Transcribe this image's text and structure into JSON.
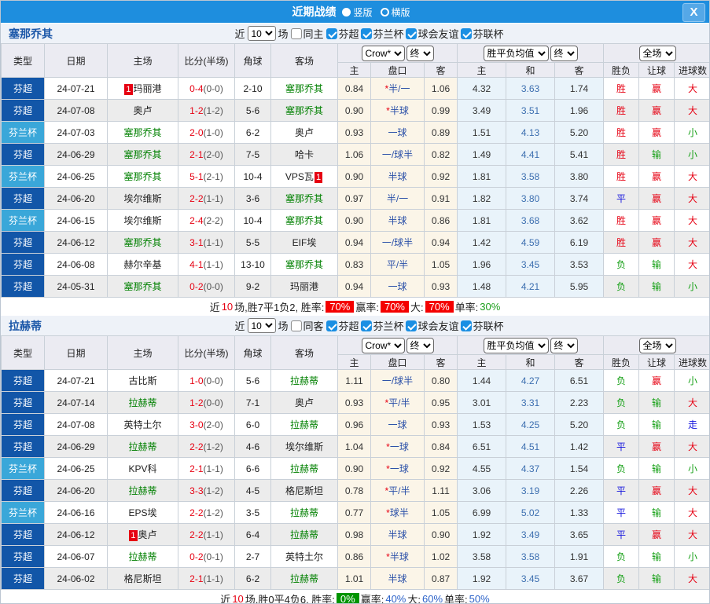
{
  "titlebar": {
    "title": "近期战绩",
    "layout_vertical": "竖版",
    "layout_horizontal": "横版",
    "close": "X"
  },
  "filter": {
    "near": "近",
    "games": "场",
    "count": "10",
    "leagues": [
      "芬超",
      "芬兰杯",
      "球会友谊",
      "芬联杯"
    ]
  },
  "table_header": {
    "type": "类型",
    "date": "日期",
    "home": "主场",
    "score": "比分(半场)",
    "corners": "角球",
    "away": "客场",
    "crow_select": "Crow*",
    "final_select": "终",
    "avg_select": "胜平负均值",
    "final_select2": "终",
    "scope_select": "全场",
    "sub_home": "主",
    "sub_handicap": "盘口",
    "sub_away": "客",
    "sub_avg_home": "主",
    "sub_avg_draw": "和",
    "sub_avg_away": "客",
    "sub_result": "胜负",
    "sub_handicap_result": "让球",
    "sub_goals": "进球数"
  },
  "league_colors": {
    "芬超": "#1256a8",
    "芬兰杯": "#3aa7d9"
  },
  "result_colors": {
    "胜": "#e60012",
    "平": "#1515dd",
    "负": "#16a016",
    "赢": "#e60012",
    "输": "#16a016",
    "走": "#1515dd",
    "大": "#e60012",
    "小": "#16a016"
  },
  "self_color": "#008000",
  "sections": [
    {
      "team": "塞那乔其",
      "same_label": "同主",
      "rows": [
        {
          "league": "芬超",
          "date": "24-07-21",
          "home": "玛丽港",
          "home_self": false,
          "home_badge": "1",
          "home_badge_pos": "before",
          "score": "0-4",
          "half": "(0-0)",
          "corners": "2-10",
          "away": "塞那乔其",
          "away_self": true,
          "odds_home": "0.84",
          "handicap_star": "*",
          "handicap": "半/一",
          "odds_away": "1.06",
          "avg_home": "4.32",
          "avg_draw": "3.63",
          "avg_away": "1.74",
          "result": "胜",
          "handicap_result": "赢",
          "goals": "大"
        },
        {
          "league": "芬超",
          "date": "24-07-08",
          "home": "奥卢",
          "home_self": false,
          "score": "1-2",
          "half": "(1-2)",
          "corners": "5-6",
          "away": "塞那乔其",
          "away_self": true,
          "odds_home": "0.90",
          "handicap_star": "*",
          "handicap": "半球",
          "odds_away": "0.99",
          "avg_home": "3.49",
          "avg_draw": "3.51",
          "avg_away": "1.96",
          "result": "胜",
          "handicap_result": "赢",
          "goals": "大"
        },
        {
          "league": "芬兰杯",
          "date": "24-07-03",
          "home": "塞那乔其",
          "home_self": true,
          "score": "2-0",
          "half": "(1-0)",
          "corners": "6-2",
          "away": "奥卢",
          "away_self": false,
          "odds_home": "0.93",
          "handicap_star": "",
          "handicap": "一球",
          "odds_away": "0.89",
          "avg_home": "1.51",
          "avg_draw": "4.13",
          "avg_away": "5.20",
          "result": "胜",
          "handicap_result": "赢",
          "goals": "小"
        },
        {
          "league": "芬超",
          "date": "24-06-29",
          "home": "塞那乔其",
          "home_self": true,
          "score": "2-1",
          "half": "(2-0)",
          "corners": "7-5",
          "away": "哈卡",
          "away_self": false,
          "odds_home": "1.06",
          "handicap_star": "",
          "handicap": "一/球半",
          "odds_away": "0.82",
          "avg_home": "1.49",
          "avg_draw": "4.41",
          "avg_away": "5.41",
          "result": "胜",
          "handicap_result": "输",
          "goals": "小"
        },
        {
          "league": "芬兰杯",
          "date": "24-06-25",
          "home": "塞那乔其",
          "home_self": true,
          "score": "5-1",
          "half": "(2-1)",
          "corners": "10-4",
          "away": "VPS瓦",
          "away_self": false,
          "away_badge": "1",
          "away_badge_pos": "after",
          "odds_home": "0.90",
          "handicap_star": "",
          "handicap": "半球",
          "odds_away": "0.92",
          "avg_home": "1.81",
          "avg_draw": "3.58",
          "avg_away": "3.80",
          "result": "胜",
          "handicap_result": "赢",
          "goals": "大"
        },
        {
          "league": "芬超",
          "date": "24-06-20",
          "home": "埃尔维斯",
          "home_self": false,
          "score": "2-2",
          "half": "(1-1)",
          "corners": "3-6",
          "away": "塞那乔其",
          "away_self": true,
          "odds_home": "0.97",
          "handicap_star": "",
          "handicap": "半/一",
          "odds_away": "0.91",
          "avg_home": "1.82",
          "avg_draw": "3.80",
          "avg_away": "3.74",
          "result": "平",
          "handicap_result": "赢",
          "goals": "大"
        },
        {
          "league": "芬兰杯",
          "date": "24-06-15",
          "home": "埃尔维斯",
          "home_self": false,
          "score": "2-4",
          "half": "(2-2)",
          "corners": "10-4",
          "away": "塞那乔其",
          "away_self": true,
          "odds_home": "0.90",
          "handicap_star": "",
          "handicap": "半球",
          "odds_away": "0.86",
          "avg_home": "1.81",
          "avg_draw": "3.68",
          "avg_away": "3.62",
          "result": "胜",
          "handicap_result": "赢",
          "goals": "大"
        },
        {
          "league": "芬超",
          "date": "24-06-12",
          "home": "塞那乔其",
          "home_self": true,
          "score": "3-1",
          "half": "(1-1)",
          "corners": "5-5",
          "away": "EIF埃",
          "away_self": false,
          "odds_home": "0.94",
          "handicap_star": "",
          "handicap": "一/球半",
          "odds_away": "0.94",
          "avg_home": "1.42",
          "avg_draw": "4.59",
          "avg_away": "6.19",
          "result": "胜",
          "handicap_result": "赢",
          "goals": "大"
        },
        {
          "league": "芬超",
          "date": "24-06-08",
          "home": "赫尔辛基",
          "home_self": false,
          "score": "4-1",
          "half": "(1-1)",
          "corners": "13-10",
          "away": "塞那乔其",
          "away_self": true,
          "odds_home": "0.83",
          "handicap_star": "",
          "handicap": "平/半",
          "odds_away": "1.05",
          "avg_home": "1.96",
          "avg_draw": "3.45",
          "avg_away": "3.53",
          "result": "负",
          "handicap_result": "输",
          "goals": "大"
        },
        {
          "league": "芬超",
          "date": "24-05-31",
          "home": "塞那乔其",
          "home_self": true,
          "score": "0-2",
          "half": "(0-0)",
          "corners": "9-2",
          "away": "玛丽港",
          "away_self": false,
          "odds_home": "0.94",
          "handicap_star": "",
          "handicap": "一球",
          "odds_away": "0.93",
          "avg_home": "1.48",
          "avg_draw": "4.21",
          "avg_away": "5.95",
          "result": "负",
          "handicap_result": "输",
          "goals": "小"
        }
      ],
      "summary": [
        {
          "t": "近",
          "s": "p"
        },
        {
          "t": "10",
          "s": "r"
        },
        {
          "t": "场,胜7平1负2, 胜率:",
          "s": "p"
        },
        {
          "t": "70%",
          "s": "rb"
        },
        {
          "t": " 赢率:",
          "s": "p"
        },
        {
          "t": "70%",
          "s": "rb"
        },
        {
          "t": " 大:",
          "s": "p"
        },
        {
          "t": "70%",
          "s": "rb"
        },
        {
          "t": " 单率:",
          "s": "p"
        },
        {
          "t": "30%",
          "s": "g"
        }
      ]
    },
    {
      "team": "拉赫蒂",
      "same_label": "同客",
      "rows": [
        {
          "league": "芬超",
          "date": "24-07-21",
          "home": "古比斯",
          "home_self": false,
          "score": "1-0",
          "half": "(0-0)",
          "corners": "5-6",
          "away": "拉赫蒂",
          "away_self": true,
          "odds_home": "1.11",
          "handicap_star": "",
          "handicap": "一/球半",
          "odds_away": "0.80",
          "avg_home": "1.44",
          "avg_draw": "4.27",
          "avg_away": "6.51",
          "result": "负",
          "handicap_result": "赢",
          "goals": "小"
        },
        {
          "league": "芬超",
          "date": "24-07-14",
          "home": "拉赫蒂",
          "home_self": true,
          "score": "1-2",
          "half": "(0-0)",
          "corners": "7-1",
          "away": "奥卢",
          "away_self": false,
          "odds_home": "0.93",
          "handicap_star": "*",
          "handicap": "平/半",
          "odds_away": "0.95",
          "avg_home": "3.01",
          "avg_draw": "3.31",
          "avg_away": "2.23",
          "result": "负",
          "handicap_result": "输",
          "goals": "大"
        },
        {
          "league": "芬超",
          "date": "24-07-08",
          "home": "英特土尔",
          "home_self": false,
          "score": "3-0",
          "half": "(2-0)",
          "corners": "6-0",
          "away": "拉赫蒂",
          "away_self": true,
          "odds_home": "0.96",
          "handicap_star": "",
          "handicap": "一球",
          "odds_away": "0.93",
          "avg_home": "1.53",
          "avg_draw": "4.25",
          "avg_away": "5.20",
          "result": "负",
          "handicap_result": "输",
          "goals": "走"
        },
        {
          "league": "芬超",
          "date": "24-06-29",
          "home": "拉赫蒂",
          "home_self": true,
          "score": "2-2",
          "half": "(1-2)",
          "corners": "4-6",
          "away": "埃尔维斯",
          "away_self": false,
          "odds_home": "1.04",
          "handicap_star": "*",
          "handicap": "一球",
          "odds_away": "0.84",
          "avg_home": "6.51",
          "avg_draw": "4.51",
          "avg_away": "1.42",
          "result": "平",
          "handicap_result": "赢",
          "goals": "大"
        },
        {
          "league": "芬兰杯",
          "date": "24-06-25",
          "home": "KPV科",
          "home_self": false,
          "score": "2-1",
          "half": "(1-1)",
          "corners": "6-6",
          "away": "拉赫蒂",
          "away_self": true,
          "odds_home": "0.90",
          "handicap_star": "*",
          "handicap": "一球",
          "odds_away": "0.92",
          "avg_home": "4.55",
          "avg_draw": "4.37",
          "avg_away": "1.54",
          "result": "负",
          "handicap_result": "输",
          "goals": "小"
        },
        {
          "league": "芬超",
          "date": "24-06-20",
          "home": "拉赫蒂",
          "home_self": true,
          "score": "3-3",
          "half": "(1-2)",
          "corners": "4-5",
          "away": "格尼斯坦",
          "away_self": false,
          "odds_home": "0.78",
          "handicap_star": "*",
          "handicap": "平/半",
          "odds_away": "1.11",
          "avg_home": "3.06",
          "avg_draw": "3.19",
          "avg_away": "2.26",
          "result": "平",
          "handicap_result": "赢",
          "goals": "大"
        },
        {
          "league": "芬兰杯",
          "date": "24-06-16",
          "home": "EPS埃",
          "home_self": false,
          "score": "2-2",
          "half": "(1-2)",
          "corners": "3-5",
          "away": "拉赫蒂",
          "away_self": true,
          "odds_home": "0.77",
          "handicap_star": "*",
          "handicap": "球半",
          "odds_away": "1.05",
          "avg_home": "6.99",
          "avg_draw": "5.02",
          "avg_away": "1.33",
          "result": "平",
          "handicap_result": "输",
          "goals": "大"
        },
        {
          "league": "芬超",
          "date": "24-06-12",
          "home": "奥卢",
          "home_self": false,
          "home_badge": "1",
          "home_badge_pos": "before",
          "score": "2-2",
          "half": "(1-1)",
          "corners": "6-4",
          "away": "拉赫蒂",
          "away_self": true,
          "odds_home": "0.98",
          "handicap_star": "",
          "handicap": "半球",
          "odds_away": "0.90",
          "avg_home": "1.92",
          "avg_draw": "3.49",
          "avg_away": "3.65",
          "result": "平",
          "handicap_result": "赢",
          "goals": "大"
        },
        {
          "league": "芬超",
          "date": "24-06-07",
          "home": "拉赫蒂",
          "home_self": true,
          "score": "0-2",
          "half": "(0-1)",
          "corners": "2-7",
          "away": "英特土尔",
          "away_self": false,
          "odds_home": "0.86",
          "handicap_star": "*",
          "handicap": "半球",
          "odds_away": "1.02",
          "avg_home": "3.58",
          "avg_draw": "3.58",
          "avg_away": "1.91",
          "result": "负",
          "handicap_result": "输",
          "goals": "小"
        },
        {
          "league": "芬超",
          "date": "24-06-02",
          "home": "格尼斯坦",
          "home_self": false,
          "score": "2-1",
          "half": "(1-1)",
          "corners": "6-2",
          "away": "拉赫蒂",
          "away_self": true,
          "odds_home": "1.01",
          "handicap_star": "",
          "handicap": "半球",
          "odds_away": "0.87",
          "avg_home": "1.92",
          "avg_draw": "3.45",
          "avg_away": "3.67",
          "result": "负",
          "handicap_result": "输",
          "goals": "大"
        }
      ],
      "summary": [
        {
          "t": "近",
          "s": "p"
        },
        {
          "t": "10",
          "s": "r"
        },
        {
          "t": "场,胜0平4负6, 胜率:",
          "s": "p"
        },
        {
          "t": "0%",
          "s": "gb"
        },
        {
          "t": " 赢率:",
          "s": "p"
        },
        {
          "t": "40%",
          "s": "b"
        },
        {
          "t": " 大:",
          "s": "p"
        },
        {
          "t": "60%",
          "s": "b"
        },
        {
          "t": " 单率:",
          "s": "p"
        },
        {
          "t": "50%",
          "s": "b"
        }
      ]
    }
  ]
}
